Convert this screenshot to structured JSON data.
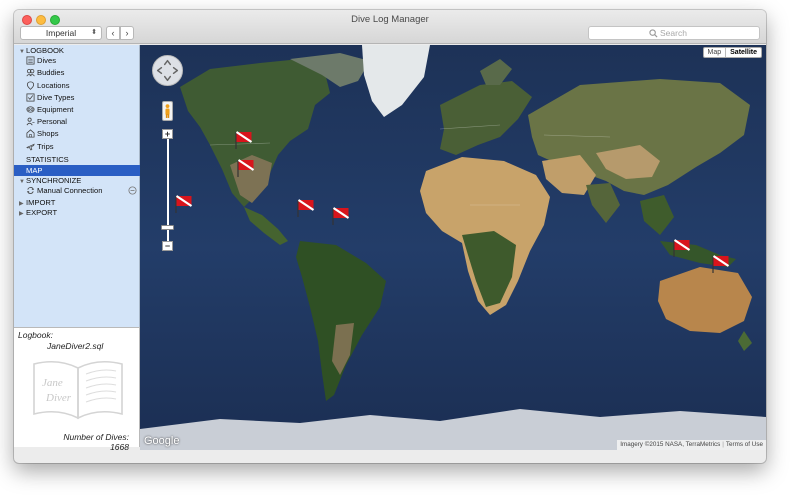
{
  "window": {
    "title": "Dive Log Manager"
  },
  "toolbar": {
    "units_select": "Imperial",
    "back_label": "‹",
    "forward_label": "›",
    "search_placeholder": "Search"
  },
  "sidebar": {
    "logbook_header": "LOGBOOK",
    "items": [
      {
        "label": "Dives",
        "icon": "dives-icon"
      },
      {
        "label": "Buddies",
        "icon": "buddies-icon"
      },
      {
        "label": "Locations",
        "icon": "locations-icon"
      },
      {
        "label": "Dive Types",
        "icon": "dive-types-icon"
      },
      {
        "label": "Equipment",
        "icon": "equipment-icon"
      },
      {
        "label": "Personal",
        "icon": "personal-icon"
      },
      {
        "label": "Shops",
        "icon": "shops-icon"
      },
      {
        "label": "Trips",
        "icon": "trips-icon"
      }
    ],
    "statistics": "STATISTICS",
    "map": "MAP",
    "synchronize_header": "SYNCHRONIZE",
    "manual_connection": "Manual Connection",
    "import": "IMPORT",
    "export": "EXPORT"
  },
  "logbook_info": {
    "label": "Logbook:",
    "file": "JaneDiver2.sql",
    "book_text": [
      "Jane",
      "Diver"
    ],
    "dives_label": "Number of Dives:",
    "dives_value": "1668"
  },
  "map": {
    "type_options": [
      "Map",
      "Satellite"
    ],
    "selected_type": "Satellite",
    "zoom_in": "+",
    "zoom_out": "−",
    "google_logo": "Google",
    "attribution": "Imagery ©2015 NASA, TerraMetrics",
    "terms": "Terms of Use",
    "flag_colors": {
      "red": "#d8141c",
      "white": "#ffffff"
    }
  }
}
